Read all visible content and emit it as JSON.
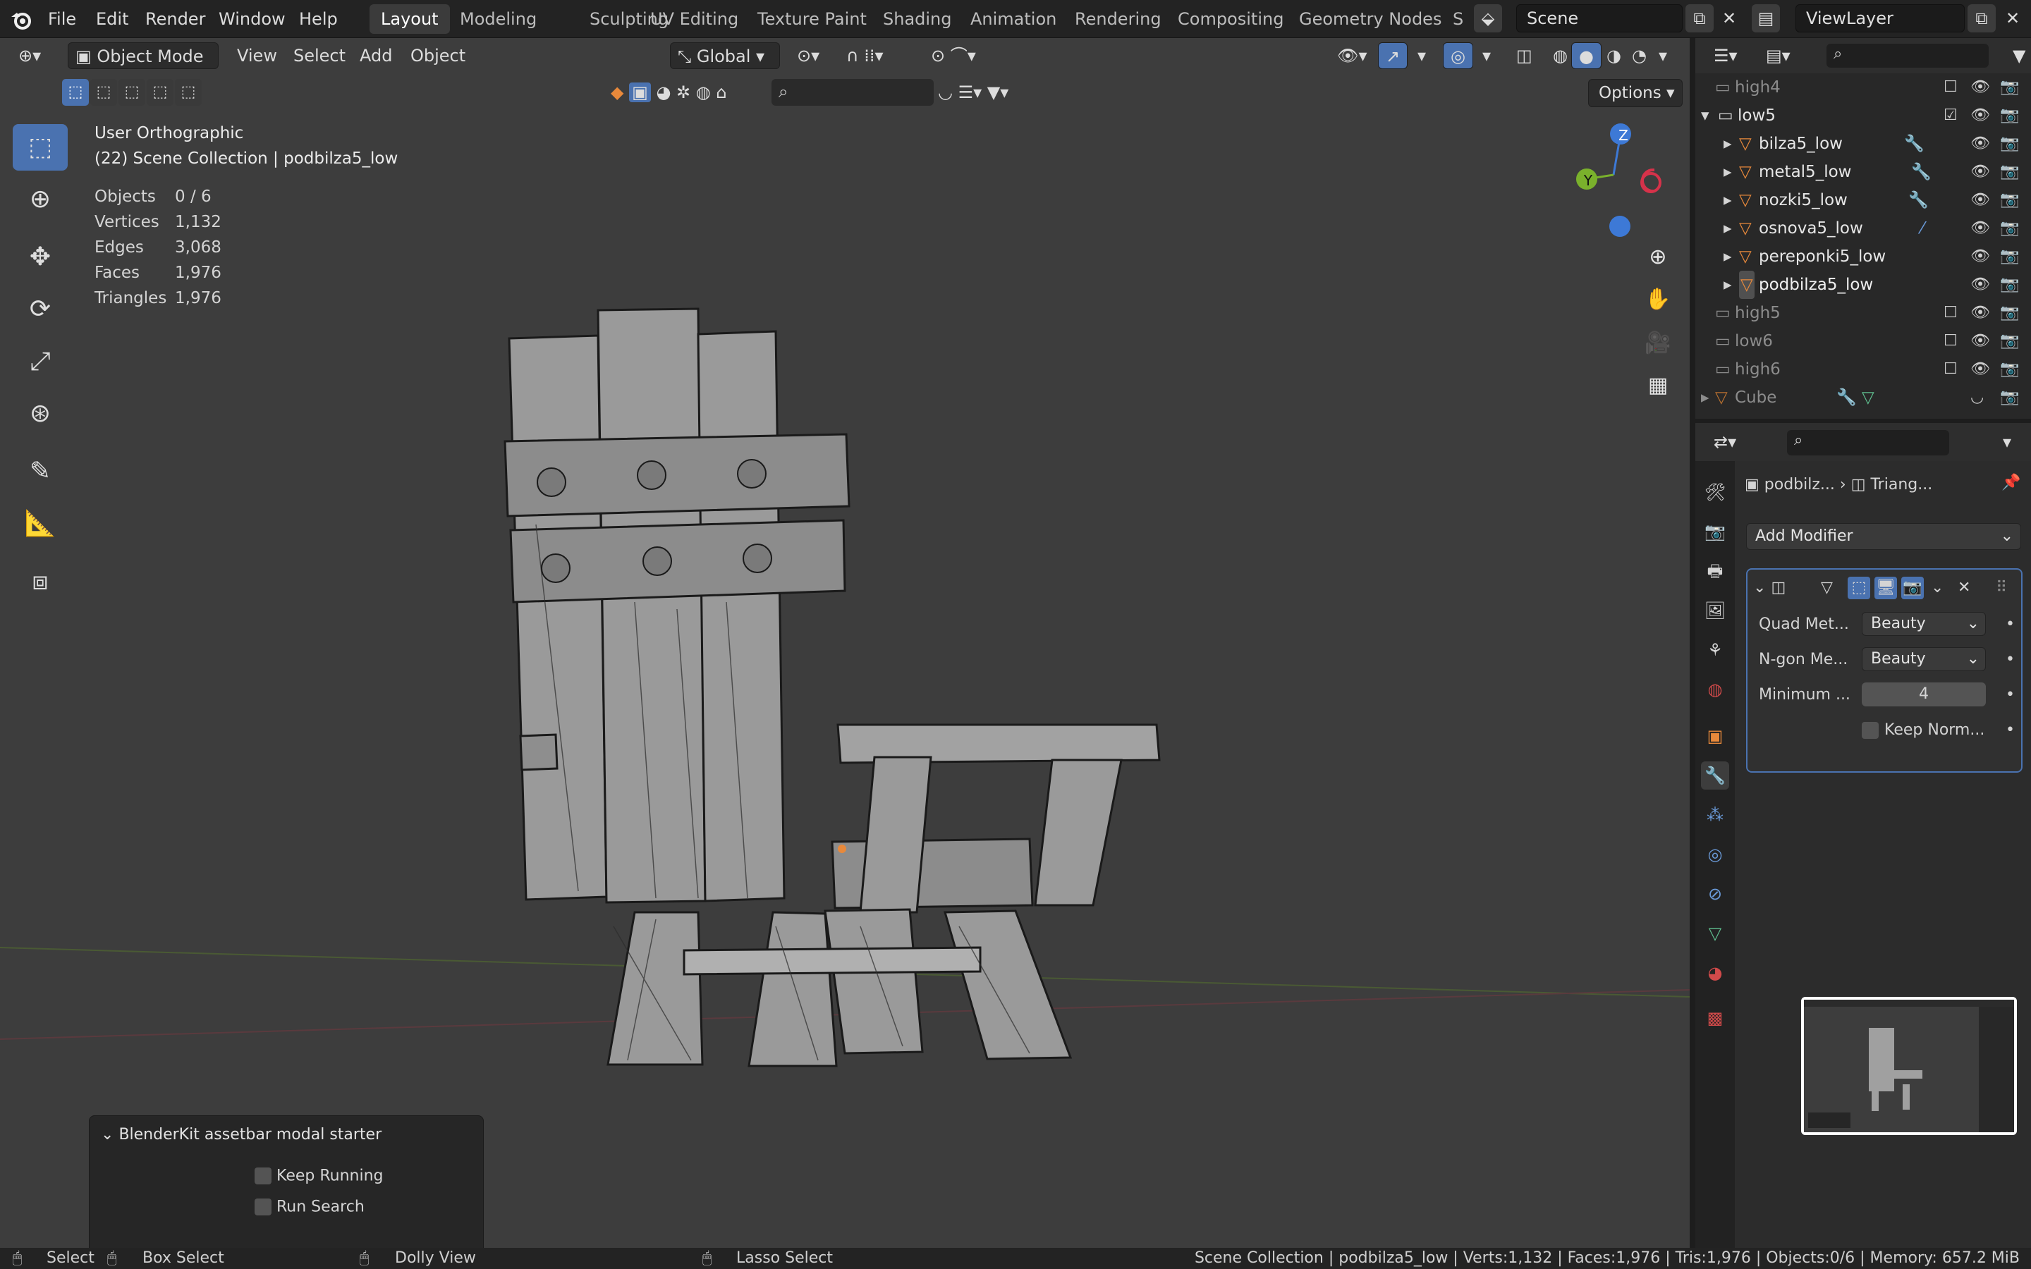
{
  "topbar": {
    "menus": [
      "File",
      "Edit",
      "Render",
      "Window",
      "Help"
    ],
    "workspaces": [
      "Layout",
      "Modeling",
      "Sculpting",
      "UV Editing",
      "Texture Paint",
      "Shading",
      "Animation",
      "Rendering",
      "Compositing",
      "Geometry Nodes",
      "S"
    ],
    "active_workspace": "Layout",
    "scene": "Scene",
    "view_layer": "ViewLayer"
  },
  "viewport_header": {
    "mode": "Object Mode",
    "menus": [
      "View",
      "Select",
      "Add",
      "Object"
    ],
    "orientation": "Global",
    "options": "Options"
  },
  "viewport_overlay": {
    "view_name": "User Orthographic",
    "collection_line": "(22) Scene Collection | podbilza5_low",
    "stats": [
      {
        "label": "Objects",
        "value": "0 / 6"
      },
      {
        "label": "Vertices",
        "value": "1,132"
      },
      {
        "label": "Edges",
        "value": "3,068"
      },
      {
        "label": "Faces",
        "value": "1,976"
      },
      {
        "label": "Triangles",
        "value": "1,976"
      }
    ]
  },
  "gizmo": {
    "z": "Z",
    "y": "Y"
  },
  "operator_panel": {
    "title": "BlenderKit assetbar modal starter",
    "keep_running": "Keep Running",
    "run_search": "Run Search"
  },
  "outliner": {
    "rows": [
      {
        "name": "high4",
        "type": "collection",
        "indent": 0,
        "dim": true,
        "checked": false
      },
      {
        "name": "low5",
        "type": "collection",
        "indent": 0,
        "dim": false,
        "checked": true,
        "expanded": true
      },
      {
        "name": "bilza5_low",
        "type": "mesh",
        "indent": 1,
        "dim": false
      },
      {
        "name": "metal5_low",
        "type": "mesh",
        "indent": 1,
        "dim": false
      },
      {
        "name": "nozki5_low",
        "type": "mesh",
        "indent": 1,
        "dim": false
      },
      {
        "name": "osnova5_low",
        "type": "mesh",
        "indent": 1,
        "dim": false
      },
      {
        "name": "pereponki5_low",
        "type": "mesh",
        "indent": 1,
        "dim": false
      },
      {
        "name": "podbilza5_low",
        "type": "mesh",
        "indent": 1,
        "dim": false,
        "active": true
      },
      {
        "name": "high5",
        "type": "collection",
        "indent": 0,
        "dim": true,
        "checked": false
      },
      {
        "name": "low6",
        "type": "collection",
        "indent": 0,
        "dim": true,
        "checked": false
      },
      {
        "name": "high6",
        "type": "collection",
        "indent": 0,
        "dim": true,
        "checked": false
      },
      {
        "name": "Cube",
        "type": "mesh",
        "indent": 0,
        "dim": true
      }
    ]
  },
  "properties": {
    "breadcrumb_object": "podbilz...",
    "breadcrumb_modifier": "Triang...",
    "add_modifier": "Add Modifier",
    "modifier": {
      "quad_label": "Quad Met...",
      "quad_value": "Beauty",
      "ngon_label": "N-gon Me...",
      "ngon_value": "Beauty",
      "min_label": "Minimum ...",
      "min_value": "4",
      "keep_normals": "Keep Norm..."
    }
  },
  "statusbar": {
    "select": "Select",
    "box_select": "Box Select",
    "dolly_view": "Dolly View",
    "lasso_select": "Lasso Select",
    "info": "Scene Collection | podbilza5_low | Verts:1,132 | Faces:1,976 | Tris:1,976 | Objects:0/6 | Memory: 657.2 MiB"
  },
  "colors": {
    "accent": "#4a72b0",
    "viewport_bg": "#3d3d3d",
    "mesh_orange": "#e8893b",
    "axis_z": "#3d79d6",
    "axis_y": "#7ab12c",
    "axis_x": "#d6324a"
  }
}
